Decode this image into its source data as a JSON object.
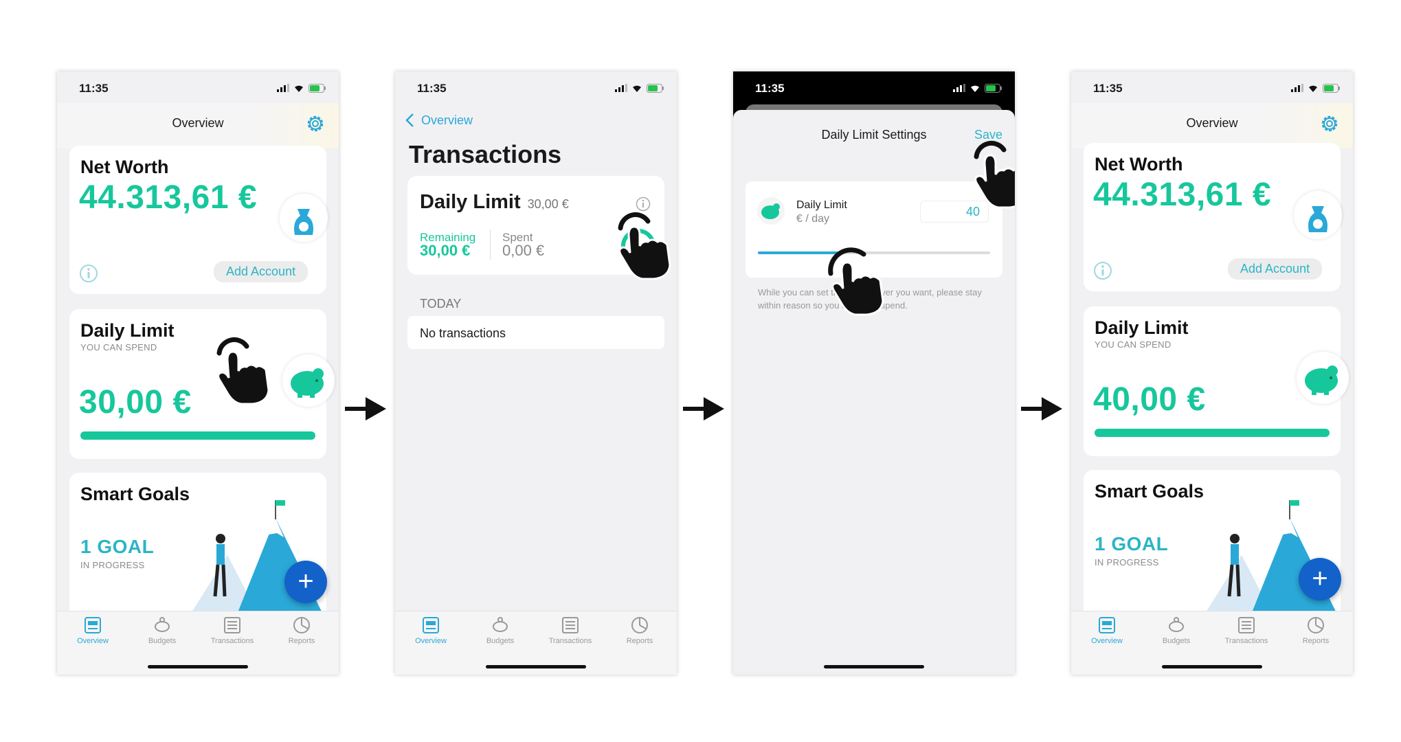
{
  "status_time": "11:35",
  "screen1": {
    "nav_title": "Overview",
    "net_worth": {
      "title": "Net Worth",
      "amount": "44.313,61 €",
      "add_account": "Add Account"
    },
    "daily_limit": {
      "title": "Daily Limit",
      "subtitle": "YOU CAN SPEND",
      "amount": "30,00 €",
      "progress": 1.0
    },
    "smart_goals": {
      "title": "Smart Goals",
      "goal_count": "1 GOAL",
      "goal_status": "IN PROGRESS"
    }
  },
  "screen2": {
    "back_label": "Overview",
    "title": "Transactions",
    "daily_limit": {
      "title": "Daily Limit",
      "limit_value": "30,00 €",
      "remaining_label": "Remaining",
      "remaining_value": "30,00 €",
      "spent_label": "Spent",
      "spent_value": "0,00 €"
    },
    "section_header": "TODAY",
    "empty_text": "No transactions"
  },
  "screen3": {
    "sheet_title": "Daily Limit Settings",
    "save_label": "Save",
    "row_title": "Daily Limit",
    "row_unit": "€ / day",
    "input_value": "40",
    "slider_level": 0.37,
    "hint_text": "While you can set this to whatever you want, please stay within reason so you don't overspend."
  },
  "screen4": {
    "nav_title": "Overview",
    "net_worth": {
      "title": "Net Worth",
      "amount": "44.313,61 €",
      "add_account": "Add Account"
    },
    "daily_limit": {
      "title": "Daily Limit",
      "subtitle": "YOU CAN SPEND",
      "amount": "40,00 €",
      "progress": 1.0
    },
    "smart_goals": {
      "title": "Smart Goals",
      "goal_count": "1 GOAL",
      "goal_status": "IN PROGRESS"
    }
  },
  "tabs": [
    "Overview",
    "Budgets",
    "Transactions",
    "Reports"
  ],
  "colors": {
    "accent_green": "#17c79c",
    "accent_teal": "#2bb5c4",
    "fab_blue": "#1262c9",
    "tab_active": "#2aa8d8"
  },
  "icons": [
    "gear-icon",
    "money-bag-icon",
    "piggy-bank-icon",
    "info-icon",
    "tap-hand-icon",
    "arrow-right-icon",
    "plus-icon",
    "back-chevron-icon"
  ]
}
